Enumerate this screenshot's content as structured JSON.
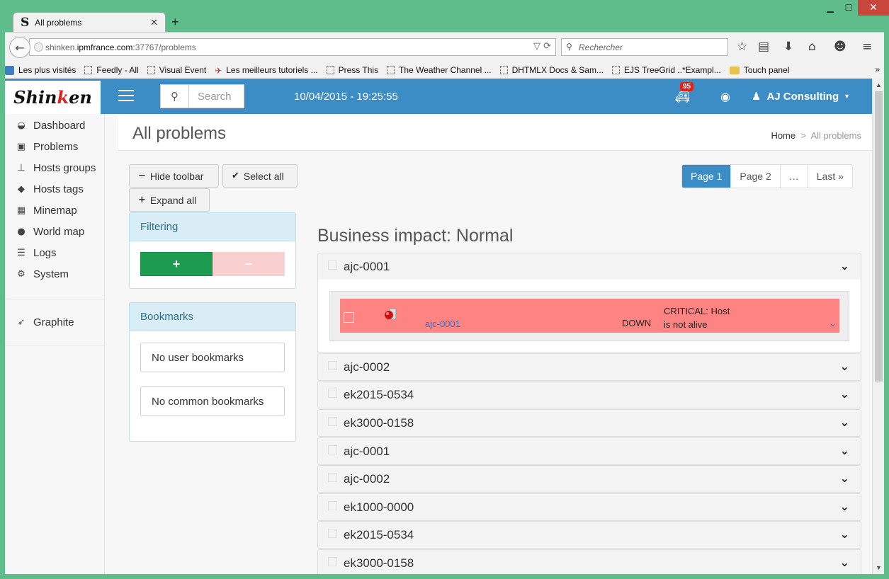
{
  "browser": {
    "tab_title": "All problems",
    "tab_logo": "S",
    "tab_close": "✕",
    "new_tab": "+",
    "url_domain_prefix": "shinken.",
    "url_domain": "ipmfrance.com",
    "url_rest": ":37767/problems",
    "search_placeholder": "Rechercher",
    "bookmarks": [
      {
        "label": "Les plus visités",
        "icon": "most-visited-icon"
      },
      {
        "label": "Feedly - All",
        "icon": "page-icon"
      },
      {
        "label": "Visual Event",
        "icon": "page-icon"
      },
      {
        "label": "Les meilleurs tutoriels ...",
        "icon": "bookmark-favicon-icon"
      },
      {
        "label": "Press This",
        "icon": "page-icon"
      },
      {
        "label": "The Weather Channel ...",
        "icon": "page-icon"
      },
      {
        "label": "DHTMLX Docs & Sam...",
        "icon": "page-icon"
      },
      {
        "label": "EJS TreeGrid ..*Exampl...",
        "icon": "page-icon"
      },
      {
        "label": "Touch panel",
        "icon": "folder-icon"
      }
    ],
    "bookmarks_more": "»"
  },
  "app": {
    "brand": {
      "pre": "Shin",
      "k": "k",
      "post": "en"
    },
    "search_placeholder": "Search",
    "datetime": "10/04/2015 - 19:25:55",
    "alert_count": "95",
    "user_name": "AJ Consulting",
    "sidebar": [
      {
        "label": "Dashboard",
        "icon": "dashboard-icon",
        "glyph": "◒"
      },
      {
        "label": "Problems",
        "icon": "ambulance-icon",
        "glyph": "▣"
      },
      {
        "label": "Hosts groups",
        "icon": "sitemap-icon",
        "glyph": "⊥"
      },
      {
        "label": "Hosts tags",
        "icon": "tags-icon",
        "glyph": "◆"
      },
      {
        "label": "Minemap",
        "icon": "table-icon",
        "glyph": "▦"
      },
      {
        "label": "World map",
        "icon": "globe-icon",
        "glyph": "●"
      },
      {
        "label": "Logs",
        "icon": "list-icon",
        "glyph": "☰"
      },
      {
        "label": "System",
        "icon": "cogs-icon",
        "glyph": "⚙"
      }
    ],
    "sidebar_extra": {
      "label": "Graphite",
      "icon": "rocket-icon",
      "glyph": "➶"
    },
    "page_title": "All problems",
    "breadcrumb": {
      "home": "Home",
      "sep": ">",
      "current": "All problems"
    },
    "toolbar": {
      "hide_toolbar": "Hide toolbar",
      "select_all": "Select all",
      "expand_all": "Expand all"
    },
    "pagination": [
      "Page 1",
      "Page 2",
      "…",
      "Last »"
    ],
    "filtering": {
      "title": "Filtering",
      "plus": "+",
      "minus": "−"
    },
    "bookmarks_panel": {
      "title": "Bookmarks",
      "user": "No user bookmarks",
      "common": "No common bookmarks"
    },
    "business_impact": "Business impact: Normal",
    "groups": [
      "ajc-0001",
      "ajc-0002",
      "ek2015-0534",
      "ek3000-0158",
      "ajc-0001",
      "ajc-0002",
      "ek1000-0000",
      "ek2015-0534",
      "ek3000-0158"
    ],
    "problem": {
      "host": "ajc-0001",
      "state": "DOWN",
      "message_line1": "CRITICAL: Host",
      "message_line2": "is not alive"
    }
  },
  "colors": {
    "topbar": "#3c8dc5",
    "problem_row": "#fe8484",
    "filter_plus": "#1d9c4f",
    "filter_minus": "#f9cfcf"
  }
}
